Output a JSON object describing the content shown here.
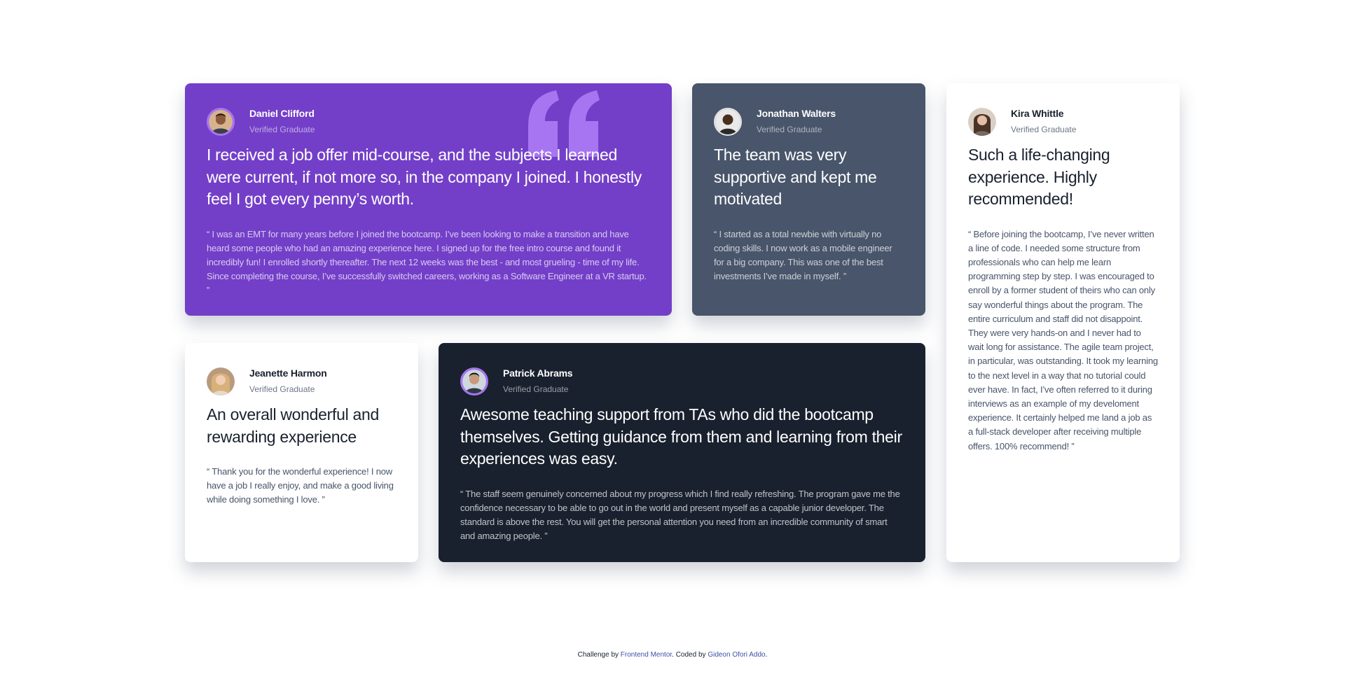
{
  "colors": {
    "purple": "#733fc8",
    "gray_blue": "#48556a",
    "white": "#ffffff",
    "dark_blue": "#19212e",
    "quote_mark": "#a775f1",
    "link": "#3e52a3"
  },
  "testimonials": [
    {
      "name": "Daniel Clifford",
      "role": "Verified Graduate",
      "headline": "I received a job offer mid-course, and the subjects I learned were current, if not more so, in the company I joined. I honestly feel I got every penny’s worth.",
      "quote": "“ I was an EMT for many years before I joined the bootcamp. I’ve been looking to make a transition and have heard some people who had an amazing experience here. I signed up for the free intro course and found it incredibly fun! I enrolled shortly thereafter. The next 12 weeks was the best - and most grueling - time of my life. Since completing the course, I’ve successfully switched careers, working as a Software Engineer at a VR startup. ”"
    },
    {
      "name": "Jonathan Walters",
      "role": "Verified Graduate",
      "headline": "The team was very supportive and kept me motivated",
      "quote": "“ I started as a total newbie with virtually no coding skills. I now work as a mobile engineer for a big company. This was one of the best investments I’ve made in myself. ”"
    },
    {
      "name": "Kira Whittle",
      "role": "Verified Graduate",
      "headline": "Such a life-changing experience. Highly recommended!",
      "quote": "“ Before joining the bootcamp, I’ve never written a line of code. I needed some structure from professionals who can help me learn programming step by step. I was encouraged to enroll by a former student of theirs who can only say wonderful things about the program. The entire curriculum and staff did not disappoint. They were very hands-on and I never had to wait long for assistance. The agile team project, in particular, was outstanding. It took my learning to the next level in a way that no tutorial could ever have. In fact, I’ve often referred to it during interviews as an example of my develoment experience. It certainly helped me land a job as a full-stack developer after receiving multiple offers. 100% recommend! ”"
    },
    {
      "name": "Jeanette Harmon",
      "role": "Verified Graduate",
      "headline": "An overall wonderful and rewarding experience",
      "quote": "“ Thank you for the wonderful experience! I now have a job I really enjoy, and make a good living while doing something I love. ”"
    },
    {
      "name": "Patrick Abrams",
      "role": "Verified Graduate",
      "headline": "Awesome teaching support from TAs who did the bootcamp themselves. Getting guidance from them and learning from their experiences was easy.",
      "quote": "“ The staff seem genuinely concerned about my progress which I find really refreshing. The program gave me the confidence necessary to be able to go out in the world and present myself as a capable junior developer. The standard is above the rest. You will get the personal attention you need from an incredible community of smart and amazing people. ”"
    }
  ],
  "footer": {
    "prefix": "Challenge by ",
    "link1": "Frontend Mentor",
    "middle": ". Coded by ",
    "link2": "Gideon Ofori Addo",
    "suffix": "."
  }
}
